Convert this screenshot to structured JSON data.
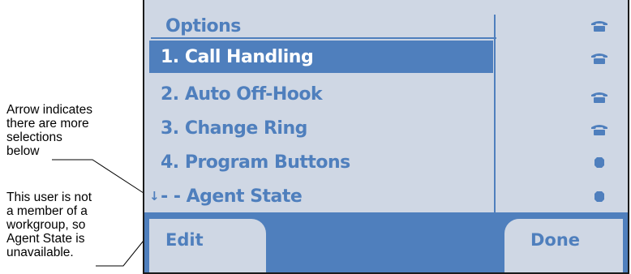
{
  "annotations": {
    "more_arrow": "Arrow indicates\nthere are more\nselections\nbelow",
    "agent_state": "This user is not\na member of a\nworkgroup, so\nAgent State is\nunavailable."
  },
  "screen": {
    "title": "Options",
    "items": [
      {
        "label": "1. Call Handling",
        "icon": "phone-icon",
        "selected": true
      },
      {
        "label": "2. Auto Off-Hook",
        "icon": "phone-icon",
        "selected": false
      },
      {
        "label": "3. Change Ring",
        "icon": "phone-icon",
        "selected": false
      },
      {
        "label": "4. Program Buttons",
        "icon": "dot-icon",
        "selected": false
      },
      {
        "label": "- - Agent State",
        "icon": "dot-icon",
        "selected": false
      }
    ],
    "more_indicator": "↓",
    "softkeys": {
      "left": "Edit",
      "right": "Done"
    }
  },
  "colors": {
    "accent": "#4f7fbd",
    "screen_bg": "#cfd7e4",
    "selected_text": "#ffffff"
  }
}
